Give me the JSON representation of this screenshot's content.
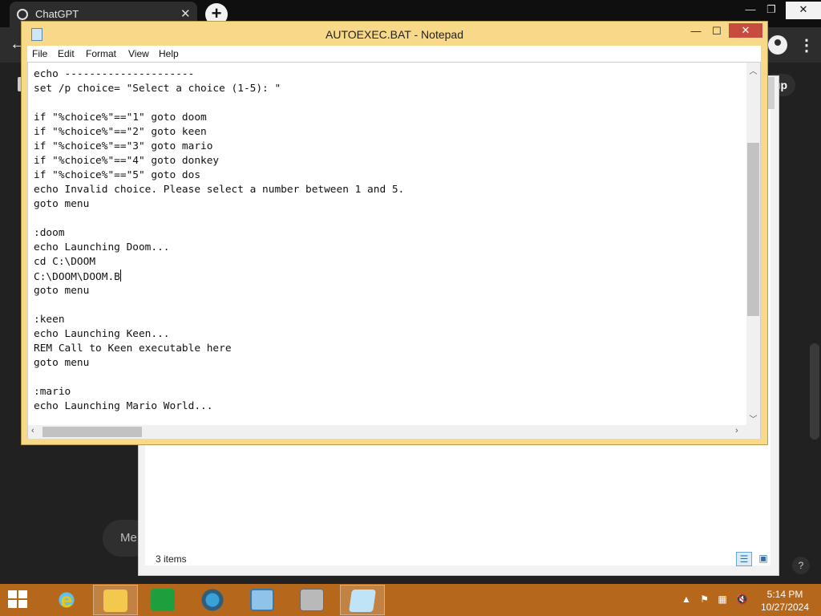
{
  "browser": {
    "tab_title": "ChatGPT",
    "tab_close": "✕",
    "new_tab": "+",
    "minimize": "—",
    "restore": "❐",
    "close": "✕",
    "back": "←",
    "signup_partial": "up",
    "message_partial": "Me",
    "help": "?"
  },
  "explorer": {
    "status": "3 items"
  },
  "notepad": {
    "title": "AUTOEXEC.BAT - Notepad",
    "min": "—",
    "max": "☐",
    "close": "✕",
    "menu": [
      "File",
      "Edit",
      "Format",
      "View",
      "Help"
    ],
    "lines": [
      "echo ---------------------",
      "set /p choice= \"Select a choice (1-5): \"",
      "",
      "if \"%choice%\"==\"1\" goto doom",
      "if \"%choice%\"==\"2\" goto keen",
      "if \"%choice%\"==\"3\" goto mario",
      "if \"%choice%\"==\"4\" goto donkey",
      "if \"%choice%\"==\"5\" goto dos",
      "echo Invalid choice. Please select a number between 1 and 5.",
      "goto menu",
      "",
      ":doom",
      "echo Launching Doom...",
      "cd C:\\DOOM",
      "C:\\DOOM\\DOOM.B",
      "goto menu",
      "",
      ":keen",
      "echo Launching Keen...",
      "REM Call to Keen executable here",
      "goto menu",
      "",
      ":mario",
      "echo Launching Mario World..."
    ],
    "caret_line": 14
  },
  "taskbar": {
    "time": "5:14 PM",
    "date": "10/27/2024",
    "tray_icons": [
      "chevron-up-icon",
      "flag-icon",
      "network-icon",
      "speaker-muted-icon"
    ],
    "apps": [
      "internet-explorer-icon",
      "file-explorer-icon",
      "store-icon",
      "media-icon",
      "remote-desktop-icon",
      "scanner-icon",
      "notepad-icon"
    ]
  },
  "colors": {
    "notepad_frame": "#f8d98a",
    "taskbar": "#b5671c",
    "close_button": "#c74b3f"
  }
}
